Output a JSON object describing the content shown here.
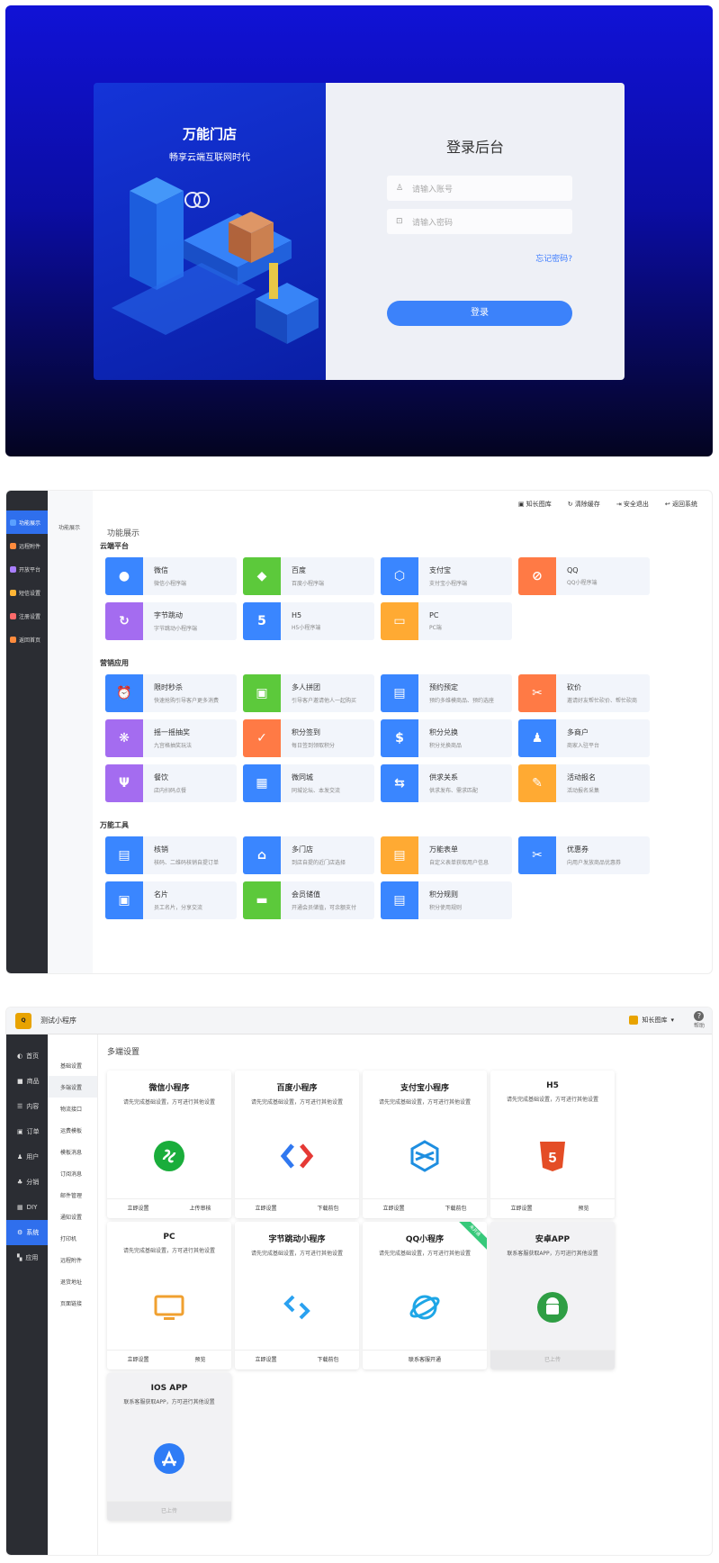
{
  "login": {
    "brand_title": "万能门店",
    "brand_sub": "畅享云端互联网时代",
    "title": "登录后台",
    "account_placeholder": "请输入账号",
    "password_placeholder": "请输入密码",
    "forgot": "忘记密码?",
    "submit": "登录"
  },
  "dash": {
    "sidebar": [
      {
        "label": "功能展示",
        "color": "#5aa0ff"
      },
      {
        "label": "远程附件",
        "color": "#ff8b3d"
      },
      {
        "label": "开放平台",
        "color": "#a97fff"
      },
      {
        "label": "短信设置",
        "color": "#ffb536"
      },
      {
        "label": "注册设置",
        "color": "#ff6b6b"
      },
      {
        "label": "返回首页",
        "color": "#ff8b3d"
      }
    ],
    "subnav": "功能展示",
    "top": {
      "user": "知长图库",
      "clear": "清除缓存",
      "logout": "安全退出",
      "back": "返回系统"
    },
    "crumb": "功能展示",
    "sections": [
      {
        "title": "云端平台",
        "items": [
          {
            "t": "微信",
            "d": "微信小程序端",
            "c": "#3a86ff",
            "i": "●"
          },
          {
            "t": "百度",
            "d": "百度小程序端",
            "c": "#5cc93b",
            "i": "◆"
          },
          {
            "t": "支付宝",
            "d": "支付宝小程序端",
            "c": "#3a86ff",
            "i": "⬡"
          },
          {
            "t": "QQ",
            "d": "QQ小程序端",
            "c": "#ff7a45",
            "i": "⊘"
          },
          {
            "t": "字节跳动",
            "d": "字节跳动小程序端",
            "c": "#a46cf0",
            "i": "↻"
          },
          {
            "t": "H5",
            "d": "H5小程序端",
            "c": "#3a86ff",
            "i": "5"
          },
          {
            "t": "PC",
            "d": "PC端",
            "c": "#ffaa33",
            "i": "▭"
          }
        ]
      },
      {
        "title": "营销应用",
        "items": [
          {
            "t": "限时秒杀",
            "d": "快速抢购引导客户更多消费",
            "c": "#3a86ff",
            "i": "⏰"
          },
          {
            "t": "多人拼团",
            "d": "引导客户邀请他人一起购买",
            "c": "#5cc93b",
            "i": "▣"
          },
          {
            "t": "预约预定",
            "d": "预约多维模商品、预约选座",
            "c": "#3a86ff",
            "i": "▤"
          },
          {
            "t": "砍价",
            "d": "邀请好友帮忙砍价、帮忙砍商",
            "c": "#ff7a45",
            "i": "✂"
          },
          {
            "t": "摇一摇抽奖",
            "d": "九宫格抽奖玩法",
            "c": "#a46cf0",
            "i": "❋"
          },
          {
            "t": "积分签到",
            "d": "每日签到领取积分",
            "c": "#ff7a45",
            "i": "✓"
          },
          {
            "t": "积分兑换",
            "d": "积分兑换商品",
            "c": "#3a86ff",
            "i": "$"
          },
          {
            "t": "多商户",
            "d": "商家入驻平台",
            "c": "#3a86ff",
            "i": "♟"
          },
          {
            "t": "餐饮",
            "d": "店内扫码点餐",
            "c": "#a46cf0",
            "i": "Ψ"
          },
          {
            "t": "微同城",
            "d": "同城论坛、本发交流",
            "c": "#3a86ff",
            "i": "▦"
          },
          {
            "t": "供求关系",
            "d": "供求发布、需求匹配",
            "c": "#3a86ff",
            "i": "⇆"
          },
          {
            "t": "活动报名",
            "d": "活动报名采集",
            "c": "#ffaa33",
            "i": "✎"
          }
        ]
      },
      {
        "title": "万能工具",
        "items": [
          {
            "t": "核销",
            "d": "核码、二维码核销自提订单",
            "c": "#3a86ff",
            "i": "▤"
          },
          {
            "t": "多门店",
            "d": "到店自提的近门店选择",
            "c": "#3a86ff",
            "i": "⌂"
          },
          {
            "t": "万能表单",
            "d": "自定义表单获取用户信息",
            "c": "#ffaa33",
            "i": "▤"
          },
          {
            "t": "优惠券",
            "d": "向用户发放商品优惠券",
            "c": "#3a86ff",
            "i": "✂"
          },
          {
            "t": "名片",
            "d": "员工名片，分享交流",
            "c": "#3a86ff",
            "i": "▣"
          },
          {
            "t": "会员储值",
            "d": "开通会员储值，可余额支付",
            "c": "#5cc93b",
            "i": "▬"
          },
          {
            "t": "积分规则",
            "d": "积分使用规则",
            "c": "#3a86ff",
            "i": "▤"
          }
        ]
      }
    ]
  },
  "multi": {
    "logo": "Q",
    "app_name": "测试小程序",
    "user": "知长图库",
    "help": "帮助",
    "sidebar": [
      {
        "label": "首页",
        "icon": "◐"
      },
      {
        "label": "商品",
        "icon": "■"
      },
      {
        "label": "内容",
        "icon": "☰"
      },
      {
        "label": "订单",
        "icon": "▣"
      },
      {
        "label": "用户",
        "icon": "♟"
      },
      {
        "label": "分销",
        "icon": "♣"
      },
      {
        "label": "DIY",
        "icon": "▦"
      },
      {
        "label": "系统",
        "icon": "⚙"
      },
      {
        "label": "应用",
        "icon": "▚"
      }
    ],
    "subnav": [
      "基础设置",
      "多端设置",
      "物流接口",
      "运费模板",
      "模板消息",
      "订阅消息",
      "邮件管理",
      "通知设置",
      "打印机",
      "远程附件",
      "退货地址",
      "页面链接"
    ],
    "crumb": "多端设置",
    "cards": [
      {
        "title": "微信小程序",
        "desc": "请先完成基础设置，方可进行其他设置",
        "left": "立即设置",
        "right": "上传审核",
        "icon": "wechat"
      },
      {
        "title": "百度小程序",
        "desc": "请先完成基础设置，方可进行其他设置",
        "left": "立即设置",
        "right": "下载前包",
        "icon": "baidu"
      },
      {
        "title": "支付宝小程序",
        "desc": "请先完成基础设置，方可进行其他设置",
        "left": "立即设置",
        "right": "下载前包",
        "icon": "alipay"
      },
      {
        "title": "H5",
        "desc": "请先完成基础设置，方可进行其他设置",
        "left": "立即设置",
        "right": "预览",
        "icon": "h5"
      },
      {
        "title": "PC",
        "desc": "请先完成基础设置，方可进行其他设置",
        "left": "立即设置",
        "right": "预览",
        "icon": "pc"
      },
      {
        "title": "字节跳动小程序",
        "desc": "请先完成基础设置，方可进行其他设置",
        "left": "立即设置",
        "right": "下载前包",
        "icon": "bytedance"
      },
      {
        "title": "QQ小程序",
        "desc": "请先完成基础设置，方可进行其他设置",
        "left": "联系客服开通",
        "right": "",
        "icon": "qq",
        "ribbon": "未开通"
      },
      {
        "title": "安卓APP",
        "desc": "联系客服获取APP，方可进行其他设置",
        "left": "已上传",
        "right": "",
        "icon": "android",
        "gray": true
      },
      {
        "title": "IOS APP",
        "desc": "联系客服获取APP，方可进行其他设置",
        "left": "已上传",
        "right": "",
        "icon": "ios",
        "gray": true
      }
    ]
  }
}
